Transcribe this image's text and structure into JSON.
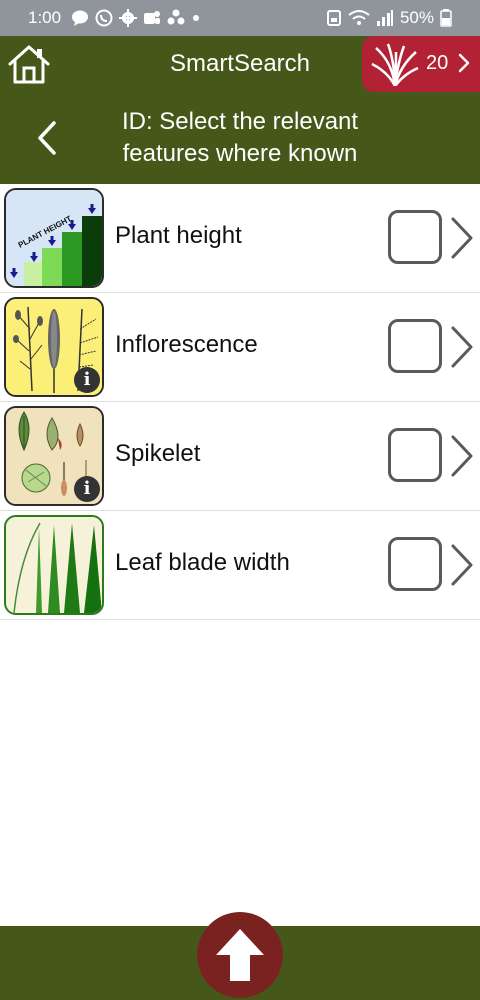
{
  "status_bar": {
    "time": "1:00",
    "battery": "50%",
    "icons": [
      "chat-icon",
      "viber-icon",
      "settings-icon",
      "teams-icon",
      "fan-icon",
      "dot-icon",
      "save-icon",
      "wifi-icon",
      "signal-icon",
      "battery-icon"
    ]
  },
  "header": {
    "home_icon": "home-icon",
    "title": "SmartSearch",
    "result_count": "20",
    "back_icon": "back-chevron-icon",
    "subtitle_line1": "ID: Select the relevant",
    "subtitle_line2": "features where known"
  },
  "features": [
    {
      "label": "Plant height",
      "thumb_text": "PLANT HEIGHT",
      "has_info": false,
      "checked": false
    },
    {
      "label": "Inflorescence",
      "has_info": true,
      "info": "i",
      "checked": false
    },
    {
      "label": "Spikelet",
      "has_info": true,
      "info": "i",
      "checked": false
    },
    {
      "label": "Leaf blade width",
      "has_info": false,
      "checked": false
    }
  ],
  "footer": {
    "up_icon": "up-arrow-icon"
  },
  "colors": {
    "header_bg": "#455719",
    "badge_bg": "#b22234",
    "up_button_bg": "#7a2220",
    "statusbar_bg": "#8f959b"
  }
}
